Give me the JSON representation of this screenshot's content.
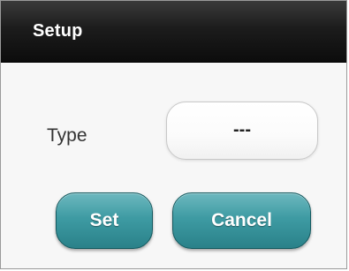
{
  "dialog": {
    "title": "Setup"
  },
  "form": {
    "type_label": "Type",
    "type_value": "---"
  },
  "buttons": {
    "set_label": "Set",
    "cancel_label": "Cancel"
  },
  "colors": {
    "titlebar": "#1c1c1c",
    "title_text": "#ffffff",
    "button_teal": "#3e9ba3",
    "button_border": "#14595f",
    "body_background": "#f7f7f7"
  }
}
